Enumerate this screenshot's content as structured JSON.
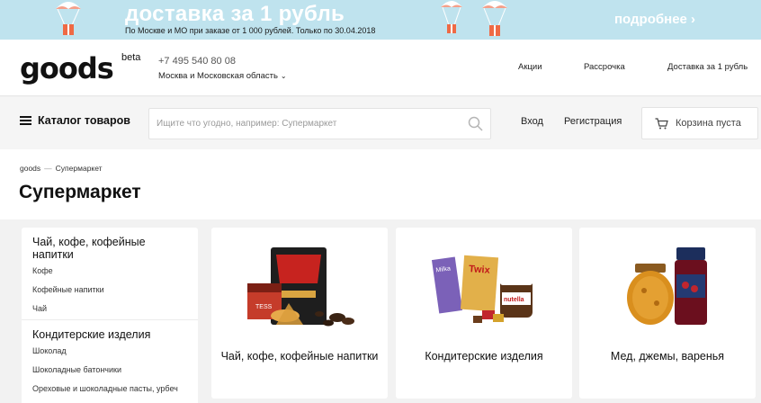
{
  "promo": {
    "title": "доставка за 1 рубль",
    "subtitle": "По Москве и МО при заказе от 1 000 рублей. Только по 30.04.2018",
    "more_label": "подробнее ›"
  },
  "header": {
    "logo_text": "goods",
    "logo_badge": "beta",
    "phone": "+7 495 540 80 08",
    "region": "Москва и Московская область",
    "links": [
      "Акции",
      "Рассрочка",
      "Доставка за 1 рубль"
    ]
  },
  "nav": {
    "catalog_label": "Каталог товаров",
    "search_placeholder": "Ищите что угодно, например: Супермаркет",
    "login_label": "Вход",
    "register_label": "Регистрация",
    "cart_label": "Корзина пуста"
  },
  "breadcrumb": {
    "home": "goods",
    "separator": "—",
    "current": "Супермаркет"
  },
  "page_title": "Супермаркет",
  "sidebar": {
    "groups": [
      {
        "heading": "Чай, кофе, кофейные напитки",
        "items": [
          "Кофе",
          "Кофейные напитки",
          "Чай"
        ]
      },
      {
        "heading": "Кондитерские изделия",
        "items": [
          "Шоколад",
          "Шоколадные батончики",
          "Ореховые и шоколадные пасты, урбеч"
        ]
      }
    ]
  },
  "categories": [
    {
      "label": "Чай, кофе, кофейные напитки",
      "image_icon": "tea-coffee-product-image"
    },
    {
      "label": "Кондитерские изделия",
      "image_icon": "sweets-product-image"
    },
    {
      "label": "Мед, джемы, варенья",
      "image_icon": "honey-jam-product-image"
    }
  ],
  "colors": {
    "banner_bg": "#bfe3ee",
    "page_bg": "#f2f2f2"
  }
}
